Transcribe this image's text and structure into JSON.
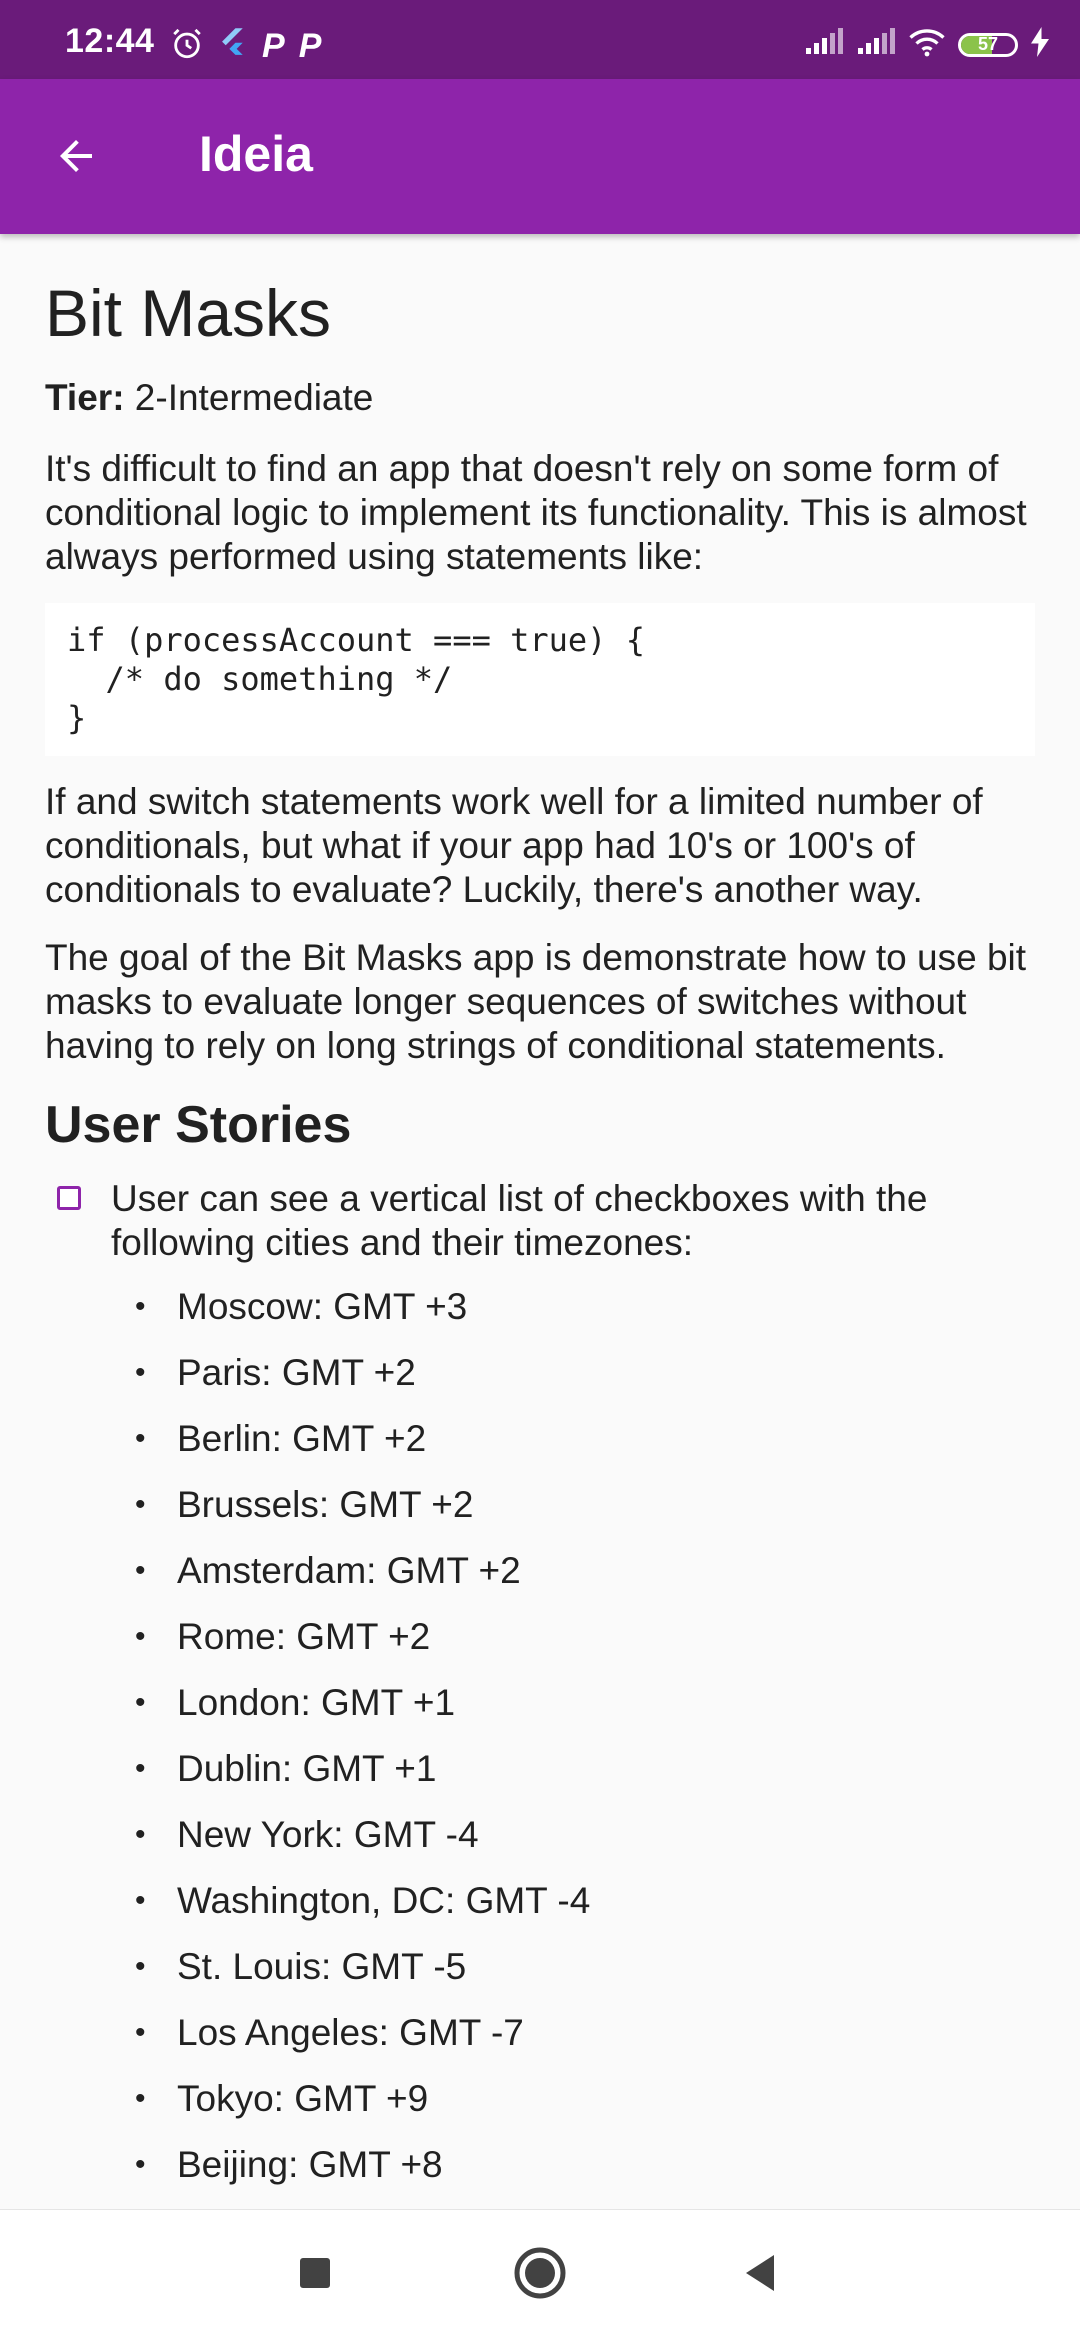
{
  "status_bar": {
    "time": "12:44",
    "battery_level": 57,
    "battery_text": "57",
    "icons": [
      "alarm-icon",
      "flutter-icon",
      "p-icon",
      "p-icon",
      "signal-icon",
      "signal-icon",
      "wifi-icon",
      "battery-icon",
      "charging-icon"
    ],
    "p_letter": "P"
  },
  "app_bar": {
    "title": "Ideia",
    "back_icon": "arrow-left-icon",
    "color": "#8e24aa",
    "status_color": "#6a1b7a"
  },
  "doc": {
    "title": "Bit Masks",
    "tier_label": "Tier:",
    "tier_value": " 2-Intermediate",
    "intro": "It's difficult to find an app that doesn't rely on some form of conditional logic to implement its functionality. This is almost always performed using statements like:",
    "code": "if (processAccount === true) {\n  /* do something */\n}",
    "para2": "If and switch statements work well for a limited number of conditionals, but what if your app had 10's or 100's of conditionals to evaluate? Luckily, there's another way.",
    "para3": "The goal of the Bit Masks app is demonstrate how to use bit masks to evaluate longer sequences of switches without having to rely on long strings of conditional statements.",
    "section_title": "User Stories",
    "story1": "User can see a vertical list of checkboxes with the following cities and their timezones:",
    "bullet": "•",
    "cities": [
      "Moscow: GMT +3",
      "Paris: GMT +2",
      "Berlin: GMT +2",
      "Brussels: GMT +2",
      "Amsterdam: GMT +2",
      "Rome: GMT +2",
      "London: GMT +1",
      "Dublin: GMT +1",
      "New York: GMT -4",
      "Washington, DC: GMT -4",
      "St. Louis: GMT -5",
      "Los Angeles: GMT -7",
      "Tokyo: GMT +9",
      "Beijing: GMT +8"
    ]
  },
  "nav_bar": {
    "icons": [
      "recent-apps-icon",
      "home-icon",
      "back-triangle-icon"
    ]
  }
}
